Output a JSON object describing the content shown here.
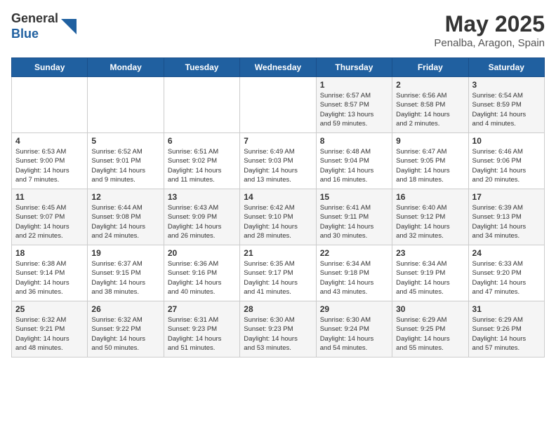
{
  "header": {
    "logo_general": "General",
    "logo_blue": "Blue",
    "main_title": "May 2025",
    "subtitle": "Penalba, Aragon, Spain"
  },
  "days_of_week": [
    "Sunday",
    "Monday",
    "Tuesday",
    "Wednesday",
    "Thursday",
    "Friday",
    "Saturday"
  ],
  "weeks": [
    [
      {
        "day": "",
        "info": ""
      },
      {
        "day": "",
        "info": ""
      },
      {
        "day": "",
        "info": ""
      },
      {
        "day": "",
        "info": ""
      },
      {
        "day": "1",
        "info": "Sunrise: 6:57 AM\nSunset: 8:57 PM\nDaylight: 13 hours\nand 59 minutes."
      },
      {
        "day": "2",
        "info": "Sunrise: 6:56 AM\nSunset: 8:58 PM\nDaylight: 14 hours\nand 2 minutes."
      },
      {
        "day": "3",
        "info": "Sunrise: 6:54 AM\nSunset: 8:59 PM\nDaylight: 14 hours\nand 4 minutes."
      }
    ],
    [
      {
        "day": "4",
        "info": "Sunrise: 6:53 AM\nSunset: 9:00 PM\nDaylight: 14 hours\nand 7 minutes."
      },
      {
        "day": "5",
        "info": "Sunrise: 6:52 AM\nSunset: 9:01 PM\nDaylight: 14 hours\nand 9 minutes."
      },
      {
        "day": "6",
        "info": "Sunrise: 6:51 AM\nSunset: 9:02 PM\nDaylight: 14 hours\nand 11 minutes."
      },
      {
        "day": "7",
        "info": "Sunrise: 6:49 AM\nSunset: 9:03 PM\nDaylight: 14 hours\nand 13 minutes."
      },
      {
        "day": "8",
        "info": "Sunrise: 6:48 AM\nSunset: 9:04 PM\nDaylight: 14 hours\nand 16 minutes."
      },
      {
        "day": "9",
        "info": "Sunrise: 6:47 AM\nSunset: 9:05 PM\nDaylight: 14 hours\nand 18 minutes."
      },
      {
        "day": "10",
        "info": "Sunrise: 6:46 AM\nSunset: 9:06 PM\nDaylight: 14 hours\nand 20 minutes."
      }
    ],
    [
      {
        "day": "11",
        "info": "Sunrise: 6:45 AM\nSunset: 9:07 PM\nDaylight: 14 hours\nand 22 minutes."
      },
      {
        "day": "12",
        "info": "Sunrise: 6:44 AM\nSunset: 9:08 PM\nDaylight: 14 hours\nand 24 minutes."
      },
      {
        "day": "13",
        "info": "Sunrise: 6:43 AM\nSunset: 9:09 PM\nDaylight: 14 hours\nand 26 minutes."
      },
      {
        "day": "14",
        "info": "Sunrise: 6:42 AM\nSunset: 9:10 PM\nDaylight: 14 hours\nand 28 minutes."
      },
      {
        "day": "15",
        "info": "Sunrise: 6:41 AM\nSunset: 9:11 PM\nDaylight: 14 hours\nand 30 minutes."
      },
      {
        "day": "16",
        "info": "Sunrise: 6:40 AM\nSunset: 9:12 PM\nDaylight: 14 hours\nand 32 minutes."
      },
      {
        "day": "17",
        "info": "Sunrise: 6:39 AM\nSunset: 9:13 PM\nDaylight: 14 hours\nand 34 minutes."
      }
    ],
    [
      {
        "day": "18",
        "info": "Sunrise: 6:38 AM\nSunset: 9:14 PM\nDaylight: 14 hours\nand 36 minutes."
      },
      {
        "day": "19",
        "info": "Sunrise: 6:37 AM\nSunset: 9:15 PM\nDaylight: 14 hours\nand 38 minutes."
      },
      {
        "day": "20",
        "info": "Sunrise: 6:36 AM\nSunset: 9:16 PM\nDaylight: 14 hours\nand 40 minutes."
      },
      {
        "day": "21",
        "info": "Sunrise: 6:35 AM\nSunset: 9:17 PM\nDaylight: 14 hours\nand 41 minutes."
      },
      {
        "day": "22",
        "info": "Sunrise: 6:34 AM\nSunset: 9:18 PM\nDaylight: 14 hours\nand 43 minutes."
      },
      {
        "day": "23",
        "info": "Sunrise: 6:34 AM\nSunset: 9:19 PM\nDaylight: 14 hours\nand 45 minutes."
      },
      {
        "day": "24",
        "info": "Sunrise: 6:33 AM\nSunset: 9:20 PM\nDaylight: 14 hours\nand 47 minutes."
      }
    ],
    [
      {
        "day": "25",
        "info": "Sunrise: 6:32 AM\nSunset: 9:21 PM\nDaylight: 14 hours\nand 48 minutes."
      },
      {
        "day": "26",
        "info": "Sunrise: 6:32 AM\nSunset: 9:22 PM\nDaylight: 14 hours\nand 50 minutes."
      },
      {
        "day": "27",
        "info": "Sunrise: 6:31 AM\nSunset: 9:23 PM\nDaylight: 14 hours\nand 51 minutes."
      },
      {
        "day": "28",
        "info": "Sunrise: 6:30 AM\nSunset: 9:23 PM\nDaylight: 14 hours\nand 53 minutes."
      },
      {
        "day": "29",
        "info": "Sunrise: 6:30 AM\nSunset: 9:24 PM\nDaylight: 14 hours\nand 54 minutes."
      },
      {
        "day": "30",
        "info": "Sunrise: 6:29 AM\nSunset: 9:25 PM\nDaylight: 14 hours\nand 55 minutes."
      },
      {
        "day": "31",
        "info": "Sunrise: 6:29 AM\nSunset: 9:26 PM\nDaylight: 14 hours\nand 57 minutes."
      }
    ]
  ]
}
